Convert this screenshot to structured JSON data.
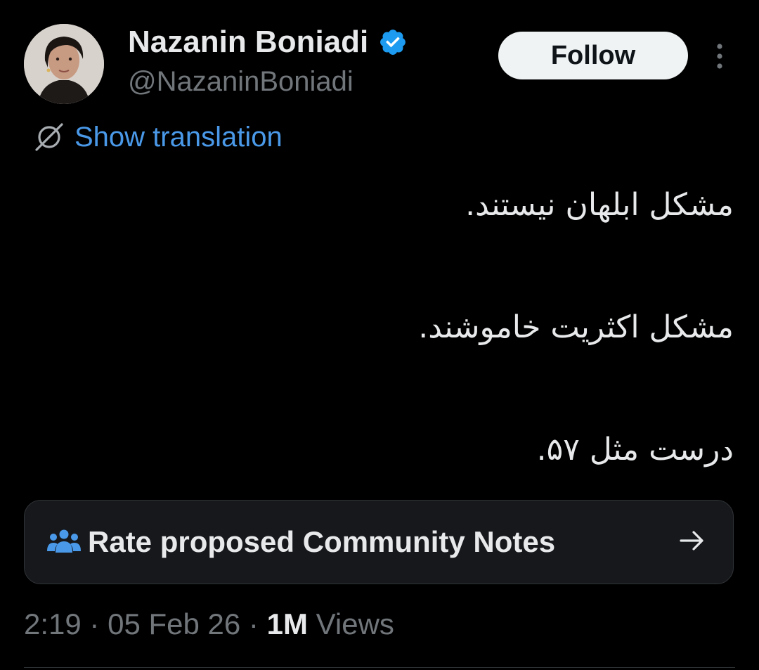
{
  "author": {
    "display_name": "Nazanin Boniadi",
    "handle": "@NazaninBoniadi",
    "verified": true
  },
  "follow_button": {
    "label": "Follow"
  },
  "more_menu": {
    "icon": "more-vertical-icon"
  },
  "translation": {
    "icon": "globe-translate-icon",
    "label": "Show translation"
  },
  "tweet": {
    "lines": [
      "مشکل ابلهان نیستند.",
      "مشکل اکثریت خاموشند.",
      "درست مثل ۵۷."
    ]
  },
  "community_notes": {
    "icon": "people-icon",
    "label": "Rate proposed Community Notes",
    "arrow_icon": "arrow-right-icon"
  },
  "meta": {
    "time": "2:19",
    "separator": "·",
    "date": "05 Feb 26",
    "views_count": "1M",
    "views_label": "Views"
  },
  "colors": {
    "background": "#000000",
    "primary_text": "#e7e9ea",
    "secondary_text": "#71767b",
    "link_blue": "#4a99e9",
    "verified_blue": "#1d9bf0",
    "card_bg": "#16181c"
  }
}
